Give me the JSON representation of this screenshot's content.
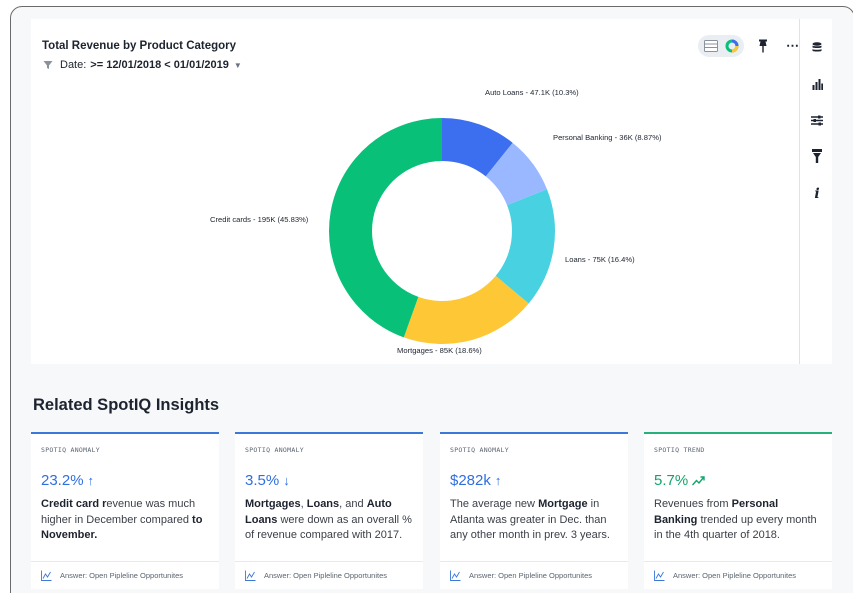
{
  "chart": {
    "title": "Total Revenue by Product Category",
    "filter_label": "Date:",
    "filter_value": ">= 12/01/2018 < 01/01/2019"
  },
  "chart_data": {
    "type": "pie",
    "donut": true,
    "title": "Total Revenue by Product Category",
    "categories": [
      "Auto Loans",
      "Personal Banking",
      "Loans",
      "Mortgages",
      "Credit cards"
    ],
    "values": [
      47.1,
      36,
      75,
      85,
      195
    ],
    "unit": "K",
    "percents": [
      10.3,
      8.87,
      16.4,
      18.6,
      45.83
    ],
    "labels": [
      "Auto Loans - 47.1K (10.3%)",
      "Personal Banking - 36K (8.87%)",
      "Loans - 75K (16.4%)",
      "Mortgages - 85K (18.6%)",
      "Credit cards - 195K (45.83%)"
    ],
    "colors": [
      "#3c6ff0",
      "#9ab8ff",
      "#48d1e0",
      "#fdc735",
      "#08c078"
    ]
  },
  "insights_title": "Related SpotIQ Insights",
  "insights": [
    {
      "kind": "SPOTIQ ANOMALY",
      "metric": "23.2%",
      "arrow": "↑",
      "desc_parts": [
        {
          "t": "Credit card ",
          "b": true
        },
        {
          "t": "r",
          "b": true
        },
        {
          "t": "evenue was much higher in December compared ",
          "b": false
        },
        {
          "t": "to November.",
          "b": true
        }
      ],
      "footer": "Answer: Open Pipleline Opportunites"
    },
    {
      "kind": "SPOTIQ ANOMALY",
      "metric": "3.5%",
      "arrow": "↓",
      "desc_parts": [
        {
          "t": "Mortgages",
          "b": true
        },
        {
          "t": ", ",
          "b": false
        },
        {
          "t": "Loans",
          "b": true
        },
        {
          "t": ", and ",
          "b": false
        },
        {
          "t": "Auto Loans",
          "b": true
        },
        {
          "t": " were down as an overall % of revenue compared with 2017.",
          "b": false
        }
      ],
      "footer": "Answer: Open Pipleline Opportunites"
    },
    {
      "kind": "SPOTIQ ANOMALY",
      "metric": "$282k",
      "arrow": "↑",
      "desc_parts": [
        {
          "t": "The average new ",
          "b": false
        },
        {
          "t": "Mortgage",
          "b": true
        },
        {
          "t": " in Atlanta was greater in Dec. than any other month in prev. 3 years.",
          "b": false
        }
      ],
      "footer": "Answer: Open Pipleline Opportunites"
    },
    {
      "kind": "SPOTIQ TREND",
      "metric": "5.7%",
      "arrow": "trend-up",
      "desc_parts": [
        {
          "t": "Revenues from ",
          "b": false
        },
        {
          "t": "Personal Banking",
          "b": true
        },
        {
          "t": " trended up every month in the 4th quarter of 2018.",
          "b": false
        }
      ],
      "footer": "Answer: Open Pipleline Opportunites"
    }
  ],
  "icons": {
    "filter": "filter-icon",
    "table": "table-view-icon",
    "chart": "chart-view-icon",
    "pin": "pin-icon",
    "more": "more-icon",
    "side": [
      "data-source-icon",
      "bar-chart-icon",
      "settings-sliders-icon",
      "filter-icon",
      "info-icon"
    ]
  },
  "toolbar_more_glyph": "⋯",
  "side_info_glyph": "i",
  "filter_caret_glyph": "▼"
}
